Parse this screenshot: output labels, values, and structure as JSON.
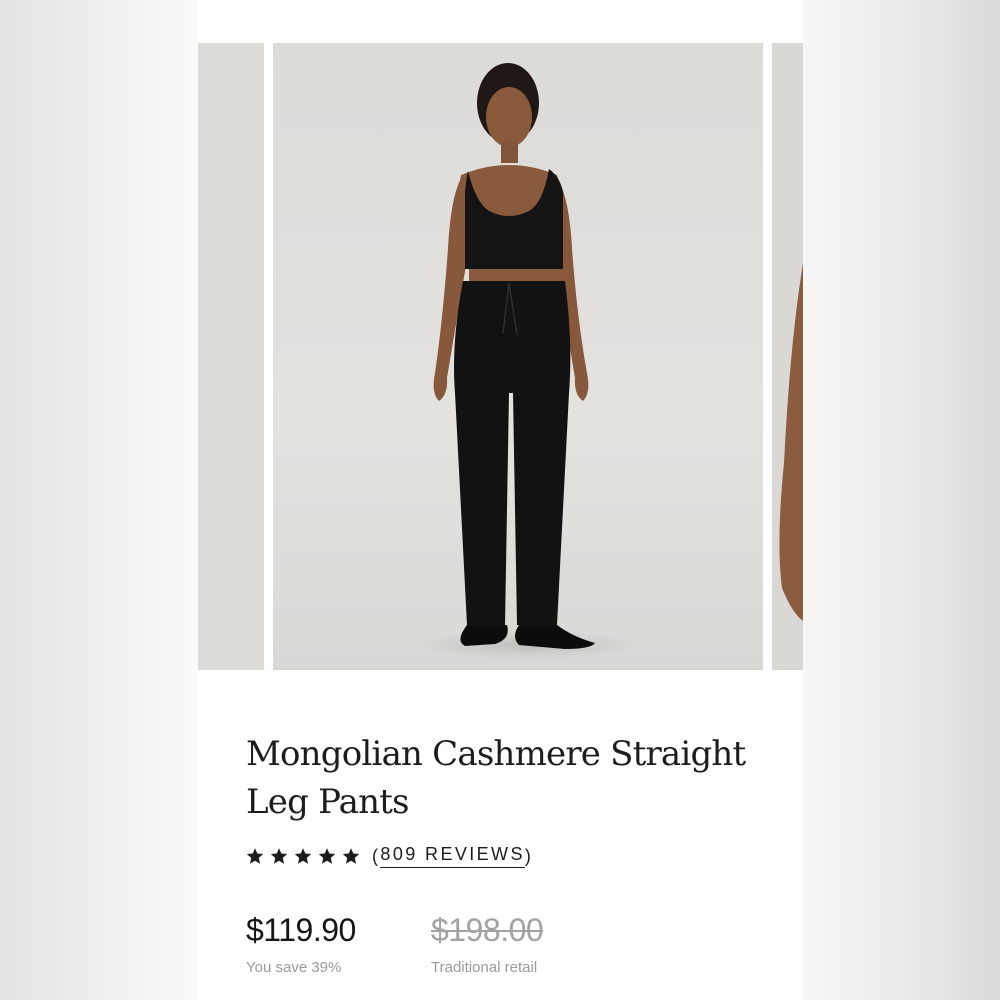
{
  "product": {
    "title": "Mongolian Cashmere Straight Leg Pants",
    "rating": 5,
    "rating_max": 5,
    "reviews_label": "809 REVIEWS",
    "review_paren_open": "(",
    "review_paren_close": ")"
  },
  "pricing": {
    "current_price": "$119.90",
    "savings_label": "You save 39%",
    "original_price": "$198.00",
    "original_label": "Traditional retail"
  },
  "icons": {
    "star": "star-icon"
  },
  "colors": {
    "text": "#1c1c1c",
    "muted": "#9a9a9a",
    "strike": "#a3a3a3",
    "image_bg": "#dedcd9"
  }
}
